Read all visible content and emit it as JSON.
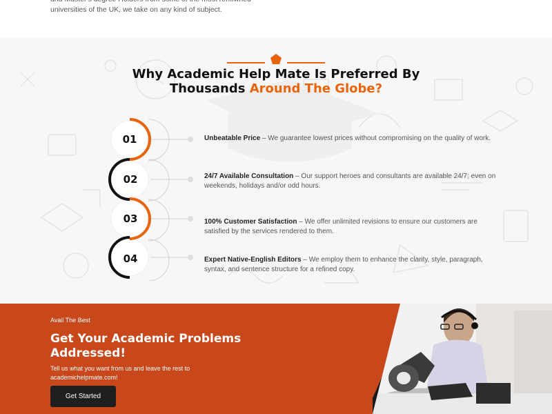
{
  "intro": {
    "text": "and Master's degree Holders from some of the most renowned universities of the UK, we take on any kind of subject."
  },
  "why_section": {
    "heading_part1": "Why Academic Help Mate Is Preferred By",
    "heading_part2": "Thousands",
    "heading_accent": "Around The Globe?",
    "accent_color": "#e8630a",
    "items": [
      {
        "number": "01",
        "title": "Unbeatable Price",
        "text": " – We guarantee lowest prices without compromising on the quality of work."
      },
      {
        "number": "02",
        "title": "24/7 Available Consultation",
        "text": " – Our support heroes and consultants are available 24/7; even on weekends, holidays and/or odd hours."
      },
      {
        "number": "03",
        "title": "100% Customer Satisfaction",
        "text": " – We offer unlimited revisions to ensure our customers are satisfied by the services rendered to them."
      },
      {
        "number": "04",
        "title": "Expert Native-English Editors",
        "text": " – We employ them to enhance the clarity, style, paragraph, syntax, and sentence structure for a refined copy."
      }
    ]
  },
  "cta": {
    "eyebrow": "Avail The Best",
    "title": "Get Your Academic Problems Addressed!",
    "description": "Tell us what you want from us and leave the rest to academichelpmate.com!",
    "button_label": "Get Started",
    "background_color": "#c8481c"
  }
}
